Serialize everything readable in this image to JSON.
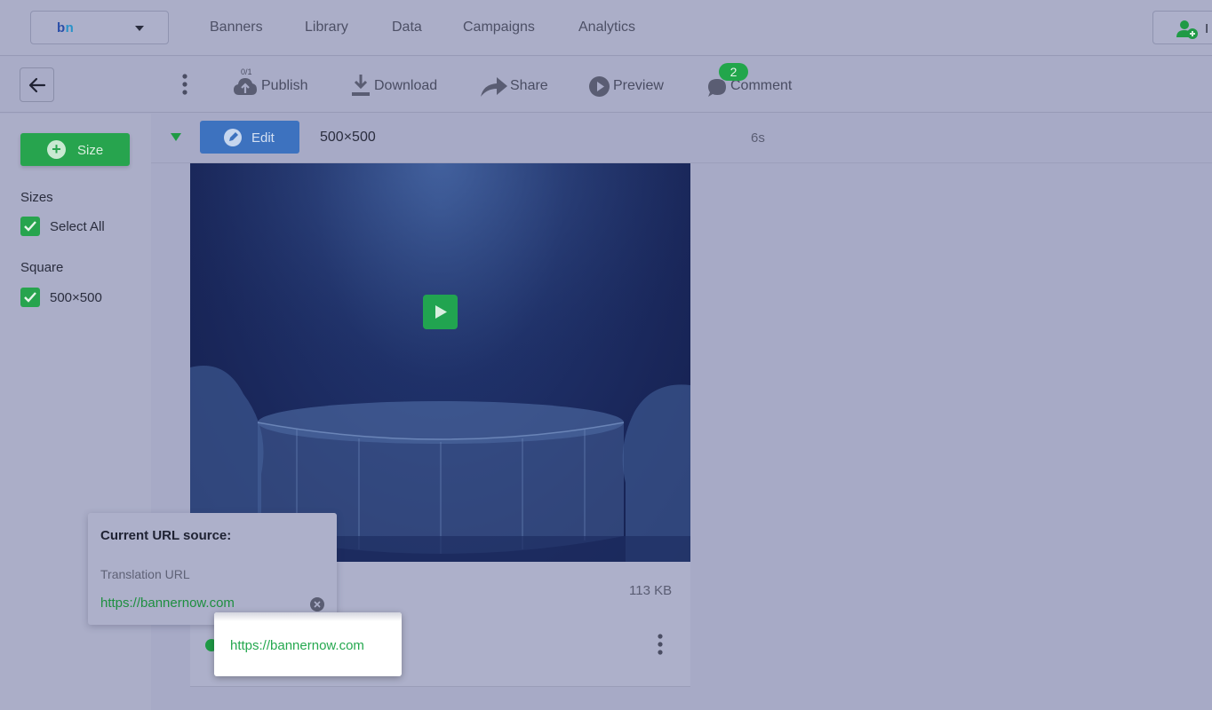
{
  "brand": {
    "logo_b": "b",
    "logo_n": "n"
  },
  "nav": {
    "items": [
      "Banners",
      "Library",
      "Data",
      "Campaigns",
      "Analytics"
    ],
    "invite_label": "I"
  },
  "toolbar": {
    "publish_count": "0/1",
    "publish": "Publish",
    "download": "Download",
    "share": "Share",
    "preview": "Preview",
    "comment": "Comment",
    "comment_badge": "2"
  },
  "sidebar": {
    "add_size": "Size",
    "sizes_heading": "Sizes",
    "select_all": "Select All",
    "group_heading": "Square",
    "size_item": "500×500"
  },
  "row": {
    "edit": "Edit",
    "size": "500×500",
    "duration": "6s"
  },
  "card": {
    "file_size": "113 KB"
  },
  "popover": {
    "title": "Current URL source:",
    "subtitle": "Translation URL",
    "url": "https://bannernow.com"
  },
  "highlight": {
    "url": "https://bannernow.com"
  },
  "colors": {
    "accent_green": "#27a44e",
    "accent_blue": "#3d72bf",
    "background": "#a7aac6"
  }
}
